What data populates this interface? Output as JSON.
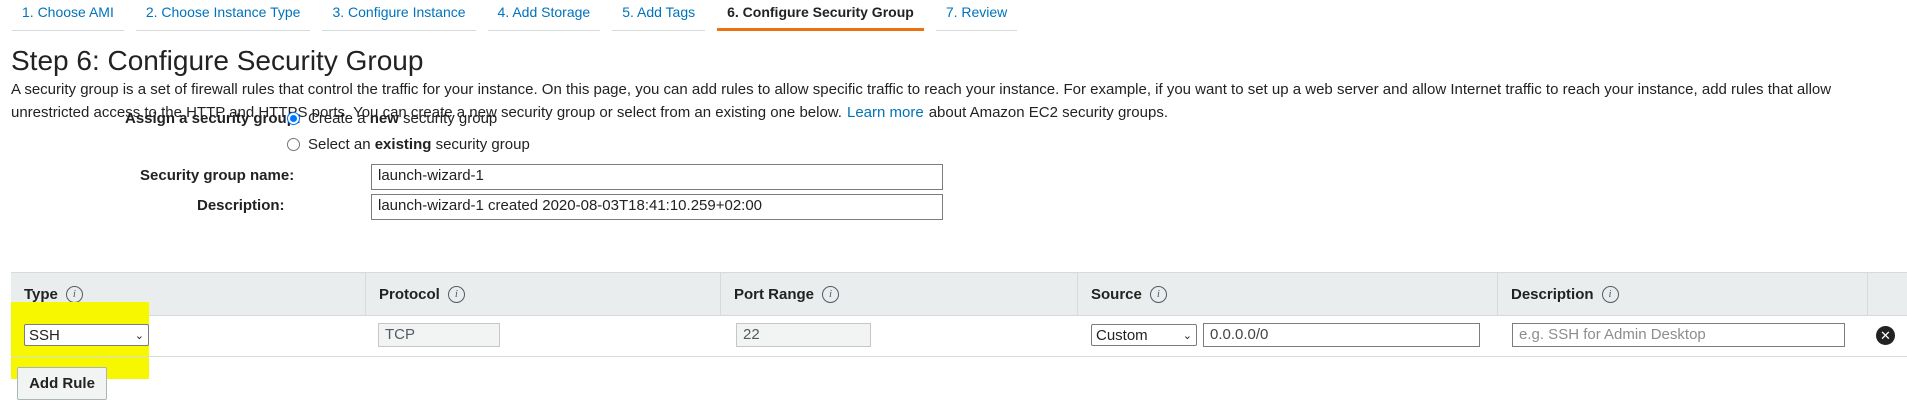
{
  "wizard": {
    "tabs": [
      {
        "label": "1. Choose AMI"
      },
      {
        "label": "2. Choose Instance Type"
      },
      {
        "label": "3. Configure Instance"
      },
      {
        "label": "4. Add Storage"
      },
      {
        "label": "5. Add Tags"
      },
      {
        "label": "6. Configure Security Group",
        "active": true
      },
      {
        "label": "7. Review"
      }
    ]
  },
  "page": {
    "title": "Step 6: Configure Security Group",
    "intro": "A security group is a set of firewall rules that control the traffic for your instance. On this page, you can add rules to allow specific traffic to reach your instance. For example, if you want to set up a web server and allow Internet traffic to reach your instance, add rules that allow unrestricted access to the HTTP and HTTPS ports. You can create a new security group or select from an existing one below.",
    "learn_more": "Learn more",
    "intro_suffix": "about Amazon EC2 security groups."
  },
  "form": {
    "assign_label": "Assign a security group:",
    "option_new": {
      "prefix": "Create a ",
      "emphasis": "new",
      "suffix": " security group",
      "checked": true
    },
    "option_existing": {
      "prefix": "Select an ",
      "emphasis": "existing",
      "suffix": " security group",
      "checked": false
    },
    "name_label": "Security group name:",
    "name_value": "launch-wizard-1",
    "description_label": "Description:",
    "description_value": "launch-wizard-1 created 2020-08-03T18:41:10.259+02:00"
  },
  "rules_table": {
    "columns": [
      "Type",
      "Protocol",
      "Port Range",
      "Source",
      "Description"
    ],
    "info_glyph": "i",
    "rows": [
      {
        "type": "SSH",
        "protocol": "TCP",
        "port_range": "22",
        "source_mode": "Custom",
        "source_value": "0.0.0.0/0",
        "description_placeholder": "e.g. SSH for Admin Desktop"
      }
    ],
    "add_rule_label": "Add Rule"
  },
  "icons": {
    "info": "info-icon",
    "remove": "remove-rule-icon",
    "dropdown": "chevron-down-icon"
  },
  "colors": {
    "link": "#0073bb",
    "active_tab_underline": "#ec7211",
    "highlight": "#f7f700"
  }
}
